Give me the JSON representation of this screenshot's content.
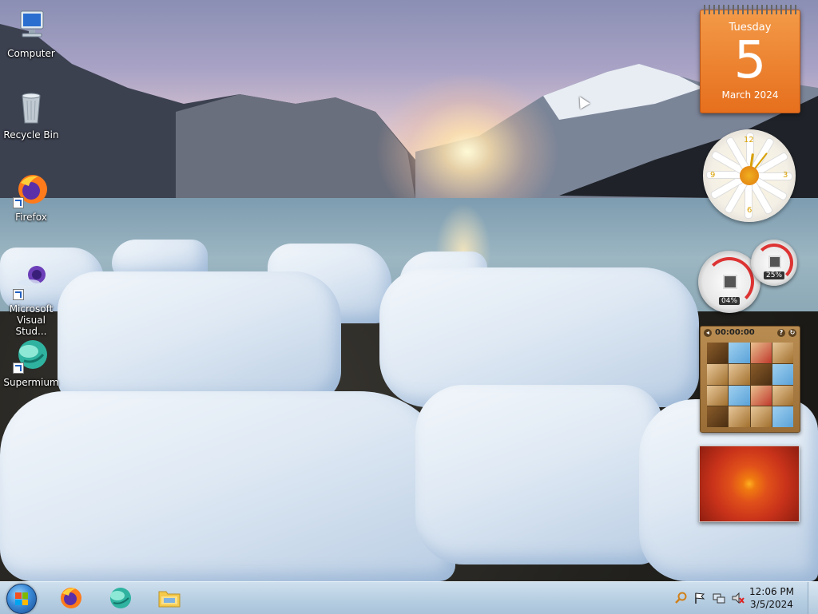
{
  "desktop": {
    "icons": [
      {
        "label": "Computer",
        "icon": "computer-icon"
      },
      {
        "label": "Recycle Bin",
        "icon": "recycle-bin-icon"
      },
      {
        "label": "Firefox",
        "icon": "firefox-icon"
      },
      {
        "label": "Microsoft Visual Stud...",
        "icon": "visual-studio-icon"
      },
      {
        "label": "Supermium",
        "icon": "supermium-icon"
      }
    ]
  },
  "gadgets": {
    "calendar": {
      "weekday": "Tuesday",
      "day": "5",
      "month_year": "March 2024"
    },
    "cpu_meter": {
      "cpu": "04%",
      "memory": "25%"
    },
    "puzzle": {
      "timer": "00:00:00",
      "help": "?"
    },
    "clock": {
      "numerals": [
        "12",
        "3",
        "6",
        "9"
      ]
    }
  },
  "taskbar": {
    "pinned": [
      {
        "name": "firefox",
        "icon": "firefox-icon"
      },
      {
        "name": "supermium",
        "icon": "supermium-icon"
      },
      {
        "name": "explorer",
        "icon": "folder-icon"
      }
    ],
    "tray": [
      "search-icon",
      "action-center-flag-icon",
      "network-icon",
      "volume-muted-icon"
    ],
    "time": "12:06 PM",
    "date": "3/5/2024"
  },
  "colors": {
    "calendar_orange": "#e66f1d",
    "taskbar": "#b9d0e3"
  }
}
